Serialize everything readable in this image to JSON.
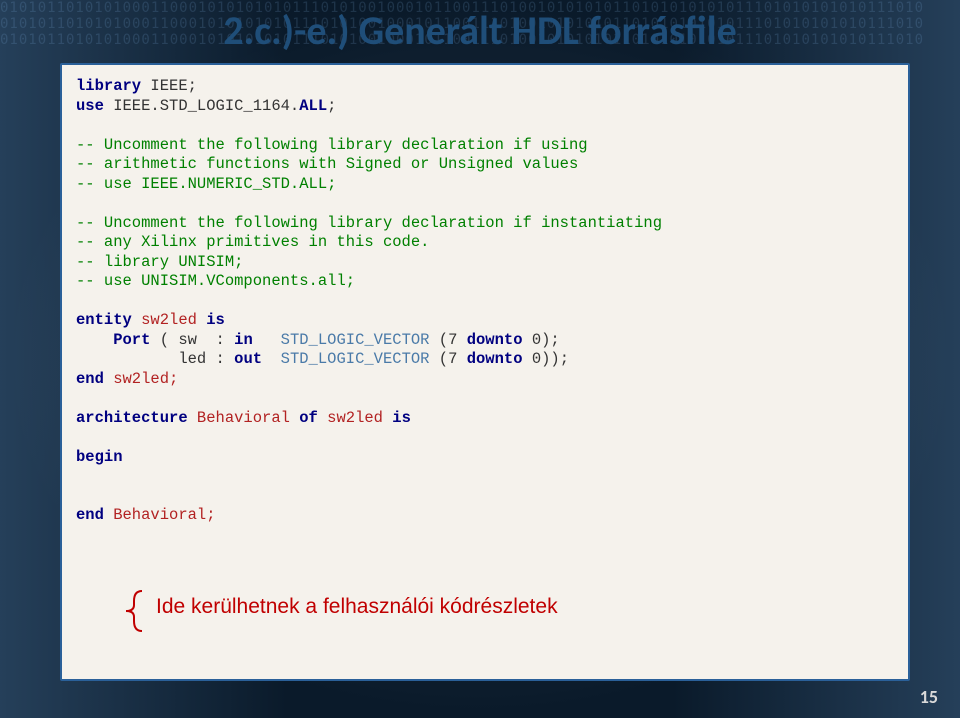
{
  "title": "2.c.)-e.) Generált HDL forrásfile",
  "code": {
    "l1a": "library",
    "l1b": " IEEE;",
    "l2a": "use",
    "l2b": " IEEE.STD_LOGIC_1164.",
    "l2c": "ALL",
    "l2d": ";",
    "c1": "-- Uncomment the following library declaration if using",
    "c2": "-- arithmetic functions with Signed or Unsigned values",
    "c3": "-- use IEEE.NUMERIC_STD.ALL;",
    "c4": "-- Uncomment the following library declaration if instantiating",
    "c5": "-- any Xilinx primitives in this code.",
    "c6": "-- library UNISIM;",
    "c7": "-- use UNISIM.VComponents.all;",
    "e1a": "entity",
    "e1b": " sw2led ",
    "e1c": "is",
    "p1a": "    Port",
    "p1b": " ( sw  : ",
    "p1c": "in",
    "p1d": "   ",
    "p1e": "STD_LOGIC_VECTOR",
    "p1f": " (7 ",
    "p1g": "downto",
    "p1h": " 0);",
    "p2a": "           led : ",
    "p2b": "out",
    "p2c": "  ",
    "p2d": "STD_LOGIC_VECTOR",
    "p2e": " (7 ",
    "p2f": "downto",
    "p2g": " 0));",
    "e2a": "end",
    "e2b": " sw2led;",
    "a1a": "architecture",
    "a1b": " Behavioral ",
    "a1c": "of",
    "a1d": " sw2led ",
    "a1e": "is",
    "b1": "begin",
    "a2a": "end",
    "a2b": " Behavioral;"
  },
  "annotation": "Ide kerülhetnek a felhasználói kódrészletek",
  "page_number": "15",
  "bg_digits_line": "01010110101010001100010101010101110101001000101100111010010101010110101010101011101010101010111010"
}
